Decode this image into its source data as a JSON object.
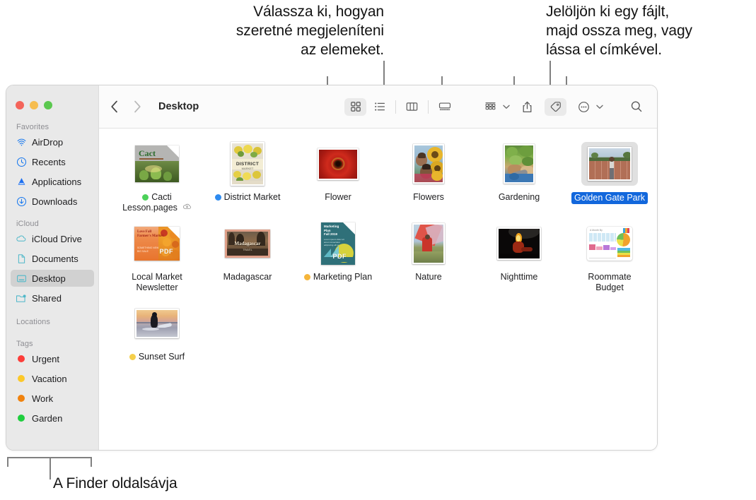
{
  "callouts": {
    "view_options": "Válassza ki, hogyan\nszeretné megjeleníteni\naz elemeket.",
    "share_tag": "Jelöljön ki egy fájlt,\nmajd ossza meg, vagy\nlássa el címkével.",
    "sidebar": "A Finder oldalsávja"
  },
  "window": {
    "traffic_lights": [
      "close-button",
      "minimize-button",
      "zoom-button"
    ],
    "title": "Desktop",
    "back_label": "‹",
    "forward_label": "›"
  },
  "sidebar": {
    "sections": [
      {
        "heading": "Favorites",
        "items": [
          {
            "label": "AirDrop",
            "icon": "airdrop-icon",
            "selected": false
          },
          {
            "label": "Recents",
            "icon": "clock-icon",
            "selected": false
          },
          {
            "label": "Applications",
            "icon": "applications-icon",
            "selected": false
          },
          {
            "label": "Downloads",
            "icon": "downloads-icon",
            "selected": false
          }
        ]
      },
      {
        "heading": "iCloud",
        "items": [
          {
            "label": "iCloud Drive",
            "icon": "cloud-icon",
            "selected": false
          },
          {
            "label": "Documents",
            "icon": "document-icon",
            "selected": false
          },
          {
            "label": "Desktop",
            "icon": "desktop-icon",
            "selected": true
          },
          {
            "label": "Shared",
            "icon": "shared-folder-icon",
            "selected": false
          }
        ]
      },
      {
        "heading": "Locations",
        "items": []
      },
      {
        "heading": "Tags",
        "items": [
          {
            "label": "Urgent",
            "icon": "tag-dot-red",
            "color": "#fc3d39",
            "selected": false
          },
          {
            "label": "Vacation",
            "icon": "tag-dot-yellow",
            "color": "#fcc82a",
            "selected": false
          },
          {
            "label": "Work",
            "icon": "tag-dot-orange",
            "color": "#f0820d",
            "selected": false
          },
          {
            "label": "Garden",
            "icon": "tag-dot-green",
            "color": "#1fce3e",
            "selected": false
          }
        ]
      }
    ]
  },
  "toolbar": {
    "view_buttons": [
      {
        "name": "icon-view-button",
        "icon": "grid-icon",
        "active": true
      },
      {
        "name": "list-view-button",
        "icon": "list-icon",
        "active": false
      },
      {
        "name": "column-view-button",
        "icon": "columns-icon",
        "active": false
      },
      {
        "name": "gallery-view-button",
        "icon": "gallery-icon",
        "active": false
      }
    ],
    "group_button": {
      "name": "group-by-button",
      "icon": "group-icon",
      "active": false
    },
    "share_button": {
      "name": "share-button",
      "icon": "share-icon",
      "active": false
    },
    "tag_button": {
      "name": "tag-button",
      "icon": "tag-icon",
      "active": true
    },
    "action_button": {
      "name": "action-menu-button",
      "icon": "ellipsis-circle-icon",
      "active": false
    },
    "search_button": {
      "name": "search-button",
      "icon": "search-icon",
      "active": false
    }
  },
  "files": [
    {
      "name": "Cacti Lesson.pages",
      "label_lines": [
        "Cacti",
        "Lesson.pages"
      ],
      "tag_color": "#4cd15a",
      "cloud_badge": true,
      "kind": "pages-document",
      "selected": false
    },
    {
      "name": "District Market",
      "label_lines": [
        "District Market"
      ],
      "tag_color": "#2e8bf0",
      "cloud_badge": false,
      "kind": "image",
      "selected": false
    },
    {
      "name": "Flower",
      "label_lines": [
        "Flower"
      ],
      "tag_color": null,
      "cloud_badge": false,
      "kind": "image",
      "selected": false
    },
    {
      "name": "Flowers",
      "label_lines": [
        "Flowers"
      ],
      "tag_color": null,
      "cloud_badge": false,
      "kind": "image",
      "selected": false
    },
    {
      "name": "Gardening",
      "label_lines": [
        "Gardening"
      ],
      "tag_color": null,
      "cloud_badge": false,
      "kind": "image",
      "selected": false
    },
    {
      "name": "Golden Gate Park",
      "label_lines": [
        "Golden Gate Park"
      ],
      "tag_color": null,
      "cloud_badge": false,
      "kind": "image",
      "selected": true
    },
    {
      "name": "Local Market Newsletter",
      "label_lines": [
        "Local Market",
        "Newsletter"
      ],
      "tag_color": null,
      "cloud_badge": false,
      "kind": "pdf-document",
      "selected": false
    },
    {
      "name": "Madagascar",
      "label_lines": [
        "Madagascar"
      ],
      "tag_color": null,
      "cloud_badge": false,
      "kind": "image",
      "selected": false
    },
    {
      "name": "Marketing Plan",
      "label_lines": [
        "Marketing Plan"
      ],
      "tag_color": "#f5b53b",
      "cloud_badge": false,
      "kind": "pdf-document",
      "selected": false
    },
    {
      "name": "Nature",
      "label_lines": [
        "Nature"
      ],
      "tag_color": null,
      "cloud_badge": false,
      "kind": "image",
      "selected": false
    },
    {
      "name": "Nighttime",
      "label_lines": [
        "Nighttime"
      ],
      "tag_color": null,
      "cloud_badge": false,
      "kind": "image",
      "selected": false
    },
    {
      "name": "Roommate Budget",
      "label_lines": [
        "Roommate",
        "Budget"
      ],
      "tag_color": null,
      "cloud_badge": false,
      "kind": "numbers-document",
      "selected": false
    },
    {
      "name": "Sunset Surf",
      "label_lines": [
        "Sunset Surf"
      ],
      "tag_color": "#f5cf4b",
      "cloud_badge": false,
      "kind": "image",
      "selected": false
    }
  ],
  "colors": {
    "selection_blue": "#1267dc",
    "sidebar_bg": "#e9e9e9",
    "toolbar_bg": "#fbfbfb",
    "accent_icon_blue": "#1577ef",
    "accent_icon_teal": "#4fb8c9",
    "callout_line": "#808080"
  }
}
